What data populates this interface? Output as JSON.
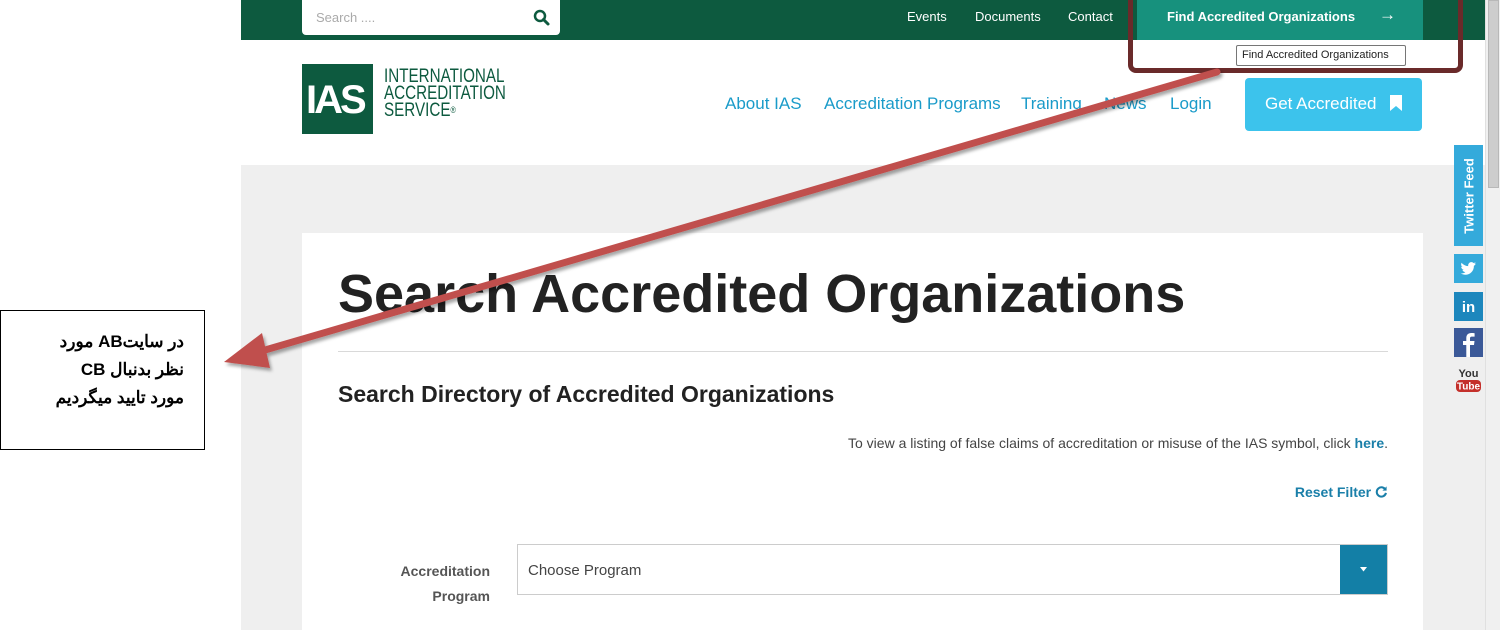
{
  "topbar": {
    "search_placeholder": "Search ....",
    "links": [
      "Events",
      "Documents",
      "Contact"
    ],
    "find_button": "Find Accredited Organizations",
    "find_arrow": "→"
  },
  "tooltip": "Find Accredited Organizations",
  "logo": {
    "mark": "IAS",
    "line1": "INTERNATIONAL",
    "line2": "ACCREDITATION",
    "line3": "SERVICE",
    "reg": "®"
  },
  "nav": {
    "items": [
      "About IAS",
      "Accreditation Programs",
      "Training",
      "News",
      "Login"
    ],
    "cta": "Get Accredited"
  },
  "main": {
    "title": "Search Accredited Organizations",
    "subtitle": "Search Directory of Accredited Organizations",
    "claims_text": "To view a listing of false claims of accreditation or misuse of the IAS symbol, click ",
    "claims_link": "here",
    "claims_end": ".",
    "reset_filter": "Reset Filter",
    "program_label": "Accreditation Program",
    "program_select": "Choose Program"
  },
  "social": {
    "twitter_feed": "Twitter Feed",
    "icons": [
      "twitter-icon",
      "linkedin-icon",
      "facebook-icon",
      "youtube-icon"
    ]
  },
  "annotation": {
    "line1": "در سایتAB مورد",
    "line2": "نظر بدنبال CB",
    "line3": "مورد تایید میگردیم"
  },
  "colors": {
    "brand_green": "#0d5a3f",
    "teal": "#17917d",
    "nav_blue": "#1a9bc9",
    "cta_blue": "#3cc3ec",
    "annotation_arrow": "#c0504d"
  }
}
